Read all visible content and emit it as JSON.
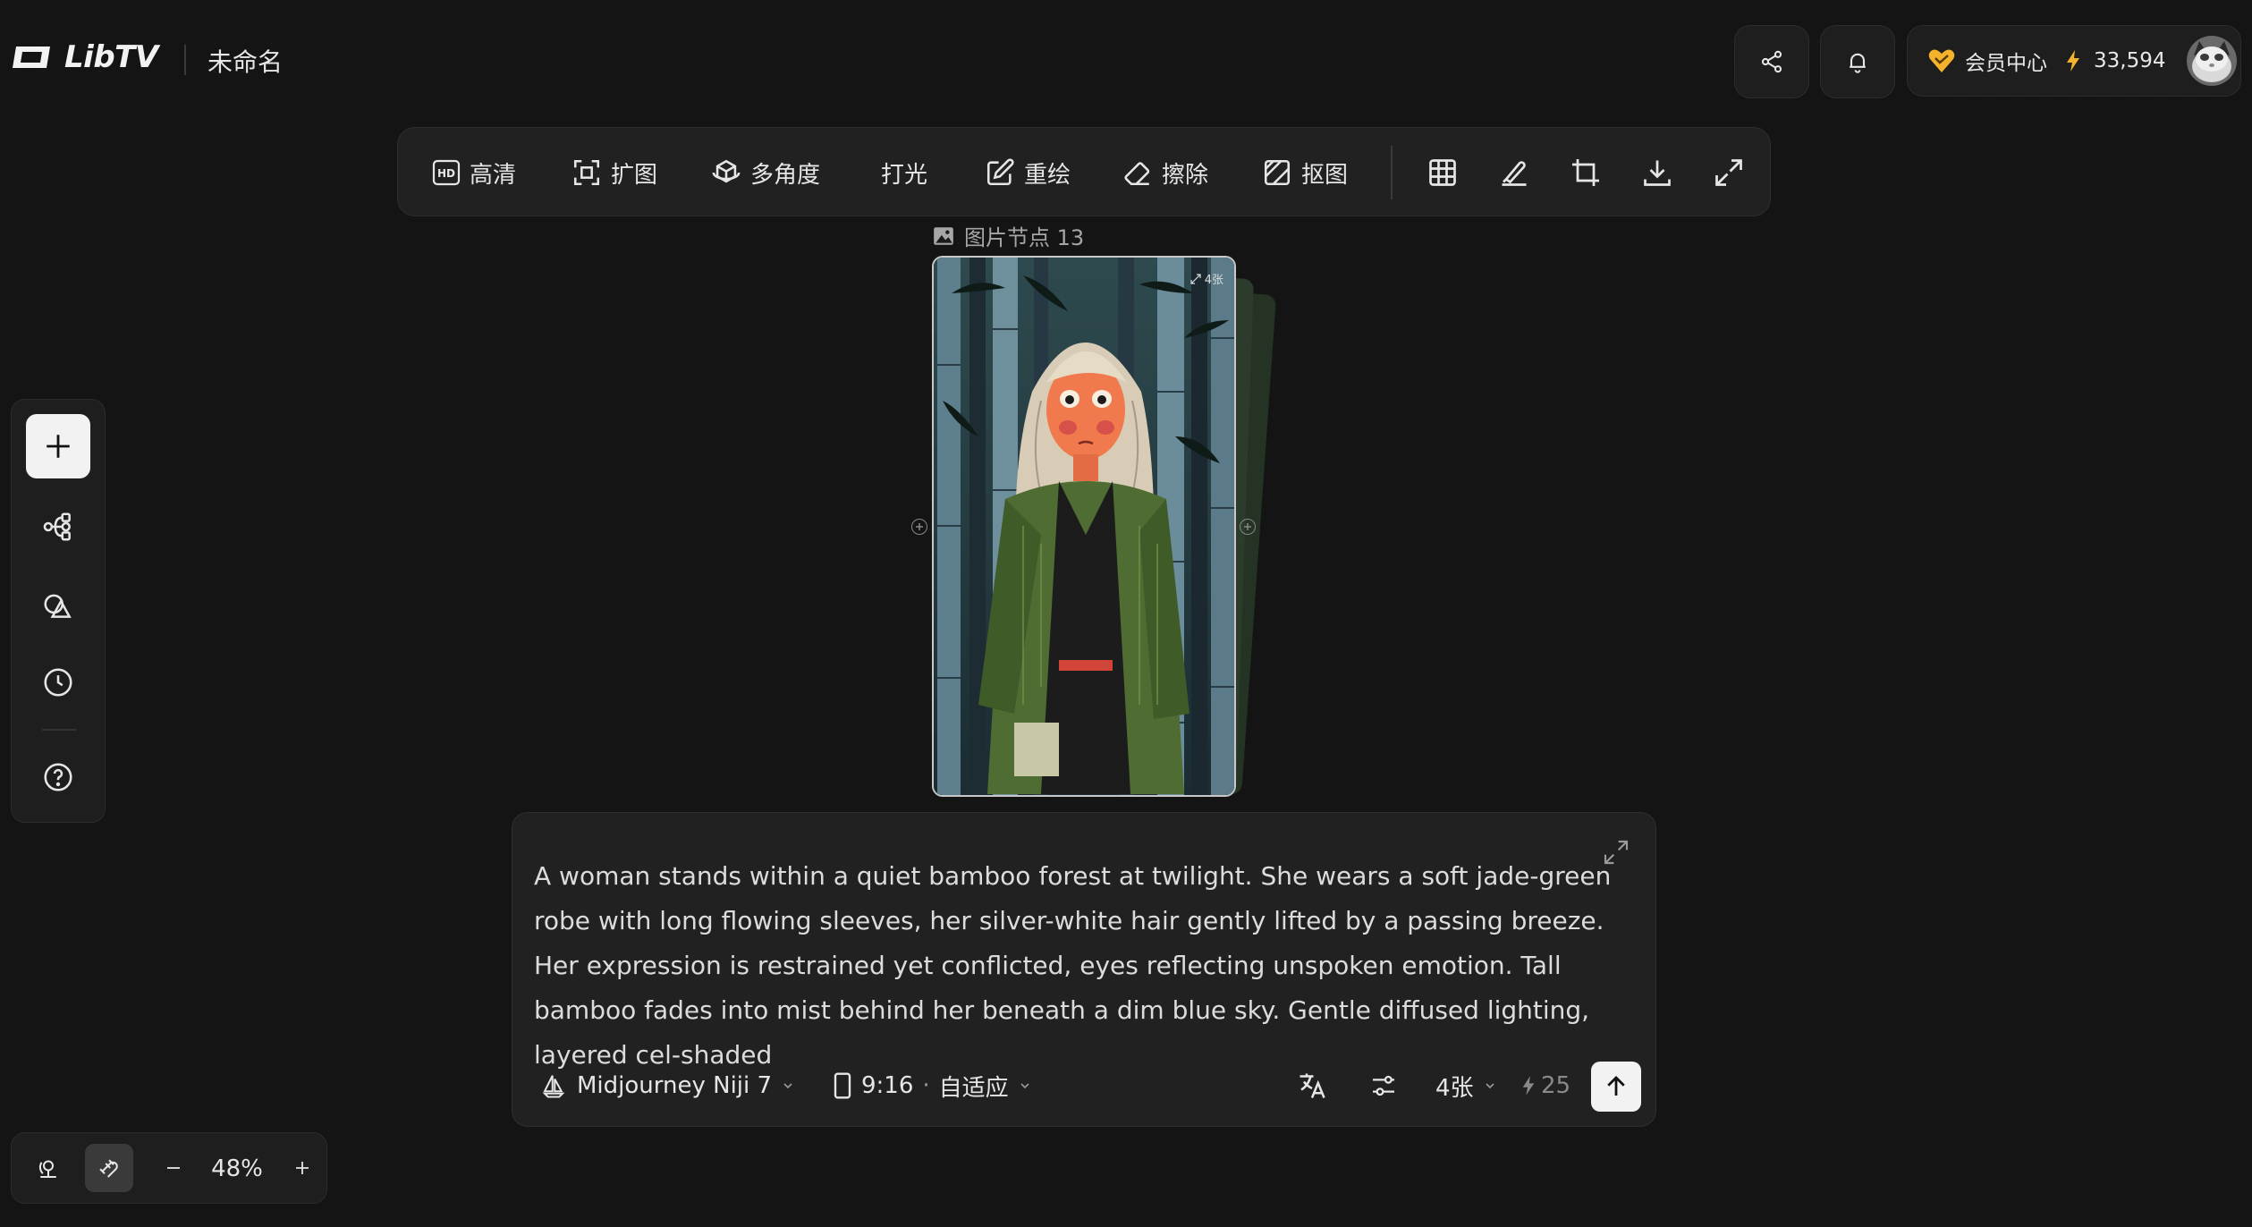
{
  "header": {
    "logo_text": "LibTV",
    "doc_title": "未命名",
    "member_label": "会员中心",
    "credits": "33,594"
  },
  "toolbar": {
    "hd_label": "高清",
    "expand_label": "扩图",
    "multi_angle_label": "多角度",
    "lighting_label": "打光",
    "redraw_label": "重绘",
    "erase_label": "擦除",
    "cutout_label": "抠图"
  },
  "node": {
    "label": "图片节点 13",
    "badge": "4张"
  },
  "zoom": {
    "value": "48%"
  },
  "prompt": {
    "text": "A woman stands within a quiet bamboo forest at twilight. She wears a soft jade-green robe with long flowing sleeves, her silver-white hair gently lifted by a passing breeze. Her expression is restrained yet conflicted, eyes reflecting unspoken emotion. Tall bamboo fades into mist behind her beneath a dim blue sky. Gentle diffused lighting, layered cel-shaded",
    "model": "Midjourney Niji 7",
    "ratio": "9:16",
    "ratio_mode": "自适应",
    "count": "4张",
    "cost": "25"
  },
  "colors": {
    "background": "#141414",
    "panel": "#212121",
    "accent_gold": "#f5b22d"
  }
}
